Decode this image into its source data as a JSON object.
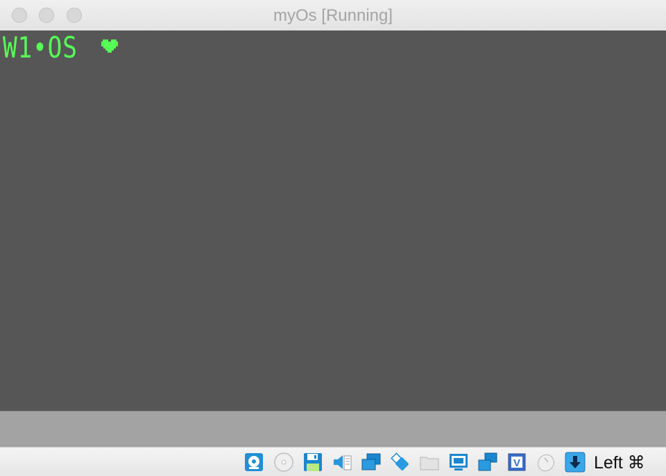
{
  "window": {
    "title": "myOs [Running]",
    "buttons": [
      "close-button",
      "minimize-button",
      "zoom-button"
    ]
  },
  "screen": {
    "text": "W1•OS",
    "text_color": "#55ff55",
    "background": "#565656"
  },
  "statusbar": {
    "icons": [
      "hard-disk-icon",
      "optical-drive-icon",
      "floppy-drive-icon",
      "audio-icon",
      "network-icon",
      "usb-icon",
      "shared-folders-icon",
      "display-icon",
      "recording-icon",
      "cpu-virtualization-icon",
      "mouse-integration-icon",
      "keyboard-capture-icon"
    ],
    "host_key": "Left ⌘"
  }
}
